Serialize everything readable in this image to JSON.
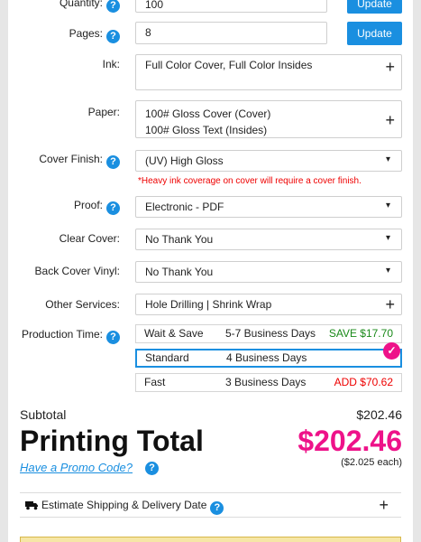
{
  "quantity": {
    "label": "Quantity:",
    "value": "100",
    "button": "Update"
  },
  "pages": {
    "label": "Pages:",
    "value": "8",
    "button": "Update"
  },
  "ink": {
    "label": "Ink:",
    "value": "Full Color Cover, Full Color Insides"
  },
  "paper": {
    "label": "Paper:",
    "line1": "100# Gloss Cover (Cover)",
    "line2": "100# Gloss Text (Insides)"
  },
  "cover_finish": {
    "label": "Cover Finish:",
    "value": "(UV) High Gloss",
    "note": "*Heavy ink coverage on cover will require a cover finish."
  },
  "proof": {
    "label": "Proof:",
    "value": "Electronic - PDF"
  },
  "clear_cover": {
    "label": "Clear Cover:",
    "value": "No Thank You"
  },
  "back_cover_vinyl": {
    "label": "Back Cover Vinyl:",
    "value": "No Thank You"
  },
  "other_services": {
    "label": "Other Services:",
    "value": "Hole Drilling | Shrink Wrap"
  },
  "production": {
    "label": "Production Time:",
    "options": [
      {
        "name": "Wait & Save",
        "days": "5-7 Business Days",
        "price": "SAVE $17.70"
      },
      {
        "name": "Standard",
        "days": "4 Business Days",
        "price": ""
      },
      {
        "name": "Fast",
        "days": "3 Business Days",
        "price": "ADD $70.62"
      }
    ],
    "selected_index": 1
  },
  "totals": {
    "subtotal_label": "Subtotal",
    "subtotal_value": "$202.46",
    "printing_total_label": "Printing Total",
    "printing_total_value": "$202.46",
    "promo_link": "Have a Promo Code?",
    "per_each": "($2.025 each)"
  },
  "shipping": {
    "label": "Estimate Shipping & Delivery Date",
    "toggle": "+"
  },
  "help_icon": "?",
  "colors": {
    "accent": "#1a8fe0",
    "total": "#ee1289",
    "save": "#1a8a1a",
    "add": "#e00000"
  }
}
